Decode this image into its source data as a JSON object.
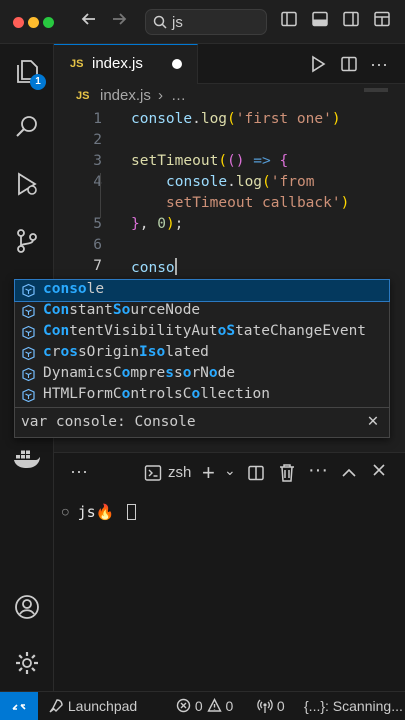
{
  "colors": {
    "accent": "#0078d4",
    "traffic_red": "#ff5f57",
    "traffic_yellow": "#febc2e",
    "traffic_green": "#28c840",
    "js_yellow": "#e8c547"
  },
  "titlebar": {
    "search_text": "js"
  },
  "activity": {
    "explorer_badge": "1"
  },
  "tab": {
    "icon_text": "JS",
    "label": "index.js"
  },
  "breadcrumb": {
    "icon_text": "JS",
    "file": "index.js",
    "more": "…"
  },
  "code": {
    "line_numbers": [
      "1",
      "2",
      "3",
      "4",
      "",
      "5",
      "6",
      "7"
    ],
    "line1": {
      "ident": "console",
      "dot": ".",
      "fn": "log",
      "open": "(",
      "str": "'first one'",
      "close": ")"
    },
    "line3": {
      "fn": "setTimeout",
      "open": "(",
      "args": "()",
      "arrow": " => ",
      "brace": "{"
    },
    "line4": {
      "ident": "console",
      "dot": ".",
      "fn": "log",
      "open": "(",
      "str": "'from"
    },
    "line4b": {
      "str": "setTimeout callback'",
      "close": ")"
    },
    "line5": {
      "brace": "}",
      "sep": ", ",
      "num": "0",
      "close": ")",
      "semi": ";"
    },
    "line7": {
      "typed": "conso"
    }
  },
  "suggest": {
    "items": [
      {
        "parts": [
          [
            "cons",
            true
          ],
          [
            "o",
            true
          ],
          [
            "le",
            false
          ]
        ]
      },
      {
        "parts": [
          [
            "Con",
            true
          ],
          [
            "stant",
            false
          ],
          [
            "So",
            true
          ],
          [
            "urceNode",
            false
          ]
        ]
      },
      {
        "parts": [
          [
            "Con",
            true
          ],
          [
            "tentVisibilityAut",
            false
          ],
          [
            "oS",
            true
          ],
          [
            "tateChangeEvent",
            false
          ]
        ]
      },
      {
        "parts": [
          [
            "c",
            true
          ],
          [
            "r",
            false
          ],
          [
            "o",
            true
          ],
          [
            "s",
            true
          ],
          [
            "sOrigin",
            false
          ],
          [
            "Iso",
            true
          ],
          [
            "lated",
            false
          ]
        ]
      },
      {
        "parts": [
          [
            "DynamicsC",
            false
          ],
          [
            "o",
            true
          ],
          [
            "mpre",
            false
          ],
          [
            "s",
            true
          ],
          [
            "s",
            false
          ],
          [
            "o",
            true
          ],
          [
            "rN",
            false
          ],
          [
            "o",
            true
          ],
          [
            "de",
            false
          ]
        ]
      },
      {
        "parts": [
          [
            "HTMLFormC",
            false
          ],
          [
            "o",
            true
          ],
          [
            "ntrols",
            false
          ],
          [
            "C",
            false
          ],
          [
            "o",
            true
          ],
          [
            "llection",
            false
          ]
        ]
      }
    ],
    "detail": "var console: Console",
    "close": "✕"
  },
  "panel": {
    "more": "···",
    "shell": "zsh",
    "prompt_dir": "js",
    "prompt_glyph": "🔥"
  },
  "status": {
    "launchpad": "Launchpad",
    "errors": "0",
    "warnings": "0",
    "ports": "0",
    "braces": "{...}",
    "scanning": ": Scanning..."
  }
}
